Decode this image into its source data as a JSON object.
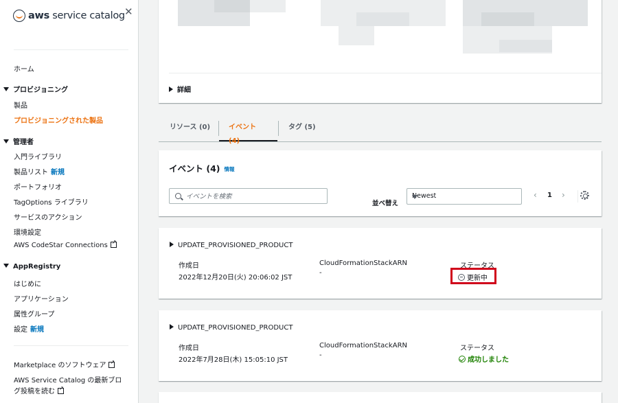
{
  "sidebar": {
    "logo_text_bold": "aws",
    "logo_text": " service catalog",
    "close_glyph": "✕",
    "home": "ホーム",
    "provisioning": {
      "header": "プロビジョニング",
      "items": [
        "製品",
        "プロビジョニングされた製品"
      ]
    },
    "admin": {
      "header": "管理者",
      "items": [
        "入門ライブラリ",
        "製品リスト",
        "ポートフォリオ",
        "TagOptions ライブラリ",
        "サービスのアクション",
        "環境設定",
        "AWS CodeStar Connections"
      ],
      "new_badge": "新規"
    },
    "appregistry": {
      "header": "AppRegistry",
      "items": [
        "はじめに",
        "アプリケーション",
        "属性グループ",
        "設定"
      ],
      "new_badge": "新規"
    },
    "footer": {
      "marketplace": "Marketplace のソフトウェア",
      "blog_line1": "AWS Service Catalog の最新ブロ",
      "blog_line2": "グ投稿を読む"
    }
  },
  "details": {
    "toggle_label": "詳細"
  },
  "tabs": [
    {
      "label": "リソース (0)",
      "active": false
    },
    {
      "label": "イベント (4)",
      "active": true
    },
    {
      "label": "タグ (5)",
      "active": false
    }
  ],
  "events_panel": {
    "title": "イベント (4)",
    "info_link": "情報",
    "search_placeholder": "イベントを検索",
    "sort_label": "並べ替え",
    "sort_value": "Newest",
    "page": "1"
  },
  "events": [
    {
      "title": "UPDATE_PROVISIONED_PRODUCT",
      "created_label": "作成日",
      "created_value": "2022年12月20日(火) 20:06:02 JST",
      "arn_label": "CloudFormationStackARN",
      "arn_value": "-",
      "status_label": "ステータス",
      "status_value": "更新中",
      "status_icon": "in-progress-icon"
    },
    {
      "title": "UPDATE_PROVISIONED_PRODUCT",
      "created_label": "作成日",
      "created_value": "2022年7月28日(木) 15:05:10 JST",
      "arn_label": "CloudFormationStackARN",
      "arn_value": "-",
      "status_label": "ステータス",
      "status_value": "成功しました",
      "status_icon": "success-check-icon"
    }
  ],
  "colors": {
    "accent": "#ec7211",
    "link": "#0073bb",
    "success": "#1d8102",
    "highlight_box": "#d0021b"
  }
}
